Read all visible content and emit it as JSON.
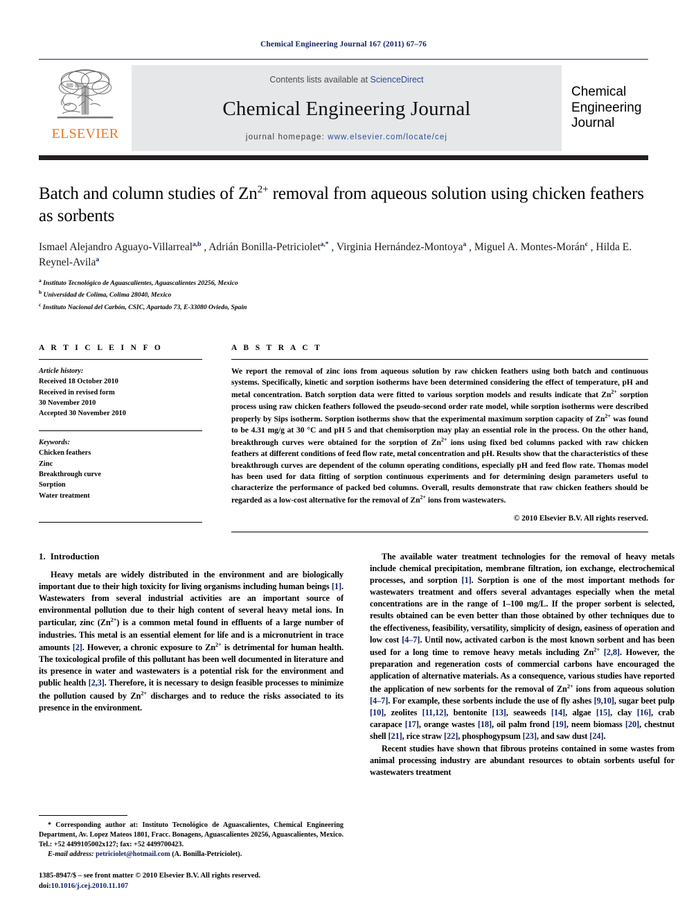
{
  "running_head": "Chemical Engineering Journal 167 (2011) 67–76",
  "banner": {
    "contents_prefix": "Contents lists available at ",
    "contents_link": "ScienceDirect",
    "journal_title": "Chemical Engineering Journal",
    "homepage_prefix": "journal homepage: ",
    "homepage_url": "www.elsevier.com/locate/cej",
    "publisher_wordmark": "ELSEVIER",
    "cover_title_line1": "Chemical",
    "cover_title_line2": "Engineering",
    "cover_title_line3": "Journal"
  },
  "article": {
    "title": "Batch and column studies of Zn2+ removal from aqueous solution using chicken feathers as sorbents",
    "title_part1": "Batch and column studies of Zn",
    "title_sup": "2+",
    "title_part2": " removal from aqueous solution using chicken feathers as sorbents",
    "authors": [
      {
        "name": "Ismael Alejandro Aguayo-Villarreal",
        "marks": "a,b"
      },
      {
        "name": "Adrián Bonilla-Petriciolet",
        "marks": "a,*"
      },
      {
        "name": "Virginia Hernández-Montoya",
        "marks": "a"
      },
      {
        "name": "Miguel A. Montes-Morán",
        "marks": "c"
      },
      {
        "name": "Hilda E. Reynel-Avila",
        "marks": "a"
      }
    ],
    "affiliations": [
      {
        "mark": "a",
        "text": "Instituto Tecnológico de Aguascalientes, Aguascalientes 20256, Mexico"
      },
      {
        "mark": "b",
        "text": "Universidad de Colima, Colima 28040, Mexico"
      },
      {
        "mark": "c",
        "text": "Instituto Nacional del Carbón, CSIC, Apartado 73, E-33080 Oviedo, Spain"
      }
    ]
  },
  "article_info": {
    "label": "A R T I C L E   I N F O",
    "history_label": "Article history:",
    "history": [
      "Received 18 October 2010",
      "Received in revised form",
      "30 November 2010",
      "Accepted 30 November 2010"
    ],
    "keywords_label": "Keywords:",
    "keywords": [
      "Chicken feathers",
      "Zinc",
      "Breakthrough curve",
      "Sorption",
      "Water treatment"
    ]
  },
  "abstract": {
    "label": "A B S T R A C T",
    "p1_a": "We report the removal of zinc ions from aqueous solution by raw chicken feathers using both batch and continuous systems. Specifically, kinetic and sorption isotherms have been determined considering the effect of temperature, pH and metal concentration. Batch sorption data were fitted to various sorption models and results indicate that Zn",
    "p1_b": " sorption process using raw chicken feathers followed the pseudo-second order rate model, while sorption isotherms were described properly by Sips isotherm. Sorption isotherms show that the experimental maximum sorption capacity of Zn",
    "p1_c": " was found to be 4.31 mg/g at 30 °C and pH 5 and that chemisorption may play an essential role in the process. On the other hand, breakthrough curves were obtained for the sorption of Zn",
    "p1_d": " ions using fixed bed columns packed with raw chicken feathers at different conditions of feed flow rate, metal concentration and pH. Results show that the characteristics of these breakthrough curves are dependent of the column operating conditions, especially pH and feed flow rate. Thomas model has been used for data fitting of sorption continuous experiments and for determining design parameters useful to characterize the performance of packed bed columns. Overall, results demonstrate that raw chicken feathers should be regarded as a low-cost alternative for the removal of Zn",
    "p1_e": " ions from wastewaters.",
    "sup": "2+",
    "copyright": "© 2010 Elsevier B.V. All rights reserved."
  },
  "body": {
    "section_number": "1.",
    "section_title": "Introduction",
    "left_p1_a": "Heavy metals are widely distributed in the environment and are biologically important due to their high toxicity for living organisms including human beings ",
    "left_p1_r1": "[1]",
    "left_p1_b": ". Wastewaters from several industrial activities are an important source of environmental pollution due to their high content of several heavy metal ions. In particular, zinc (Zn",
    "left_p1_sup1": "2+",
    "left_p1_c": ") is a common metal found in effluents of a large number of industries. This metal is an essential element for life and is a micronutrient in trace amounts ",
    "left_p1_r2": "[2]",
    "left_p1_d": ". However, a chronic exposure to Zn",
    "left_p1_sup2": "2+",
    "left_p1_e": " is detrimental for human health. The toxicological profile of this pollutant has been well documented in literature and its presence in water and wastewaters is a potential risk for the environment and public health ",
    "left_p1_r3": "[2,3]",
    "left_p1_f": ". Therefore, it is necessary to design feasible processes to minimize the pollution caused by Zn",
    "left_p1_sup3": "2+",
    "left_p1_g": " discharges and to reduce the risks associated to its presence in the environment.",
    "right_p1_a": "The available water treatment technologies for the removal of heavy metals include chemical precipitation, membrane filtration, ion exchange, electrochemical processes, and sorption ",
    "right_p1_r1": "[1]",
    "right_p1_b": ". Sorption is one of the most important methods for wastewaters treatment and offers several advantages especially when the metal concentrations are in the range of 1–100 mg/L. If the proper sorbent is selected, results obtained can be even better than those obtained by other techniques due to the effectiveness, feasibility, versatility, simplicity of design, easiness of operation and low cost ",
    "right_p1_r2": "[4–7]",
    "right_p1_c": ". Until now, activated carbon is the most known sorbent and has been used for a long time to remove heavy metals including Zn",
    "right_p1_sup1": "2+",
    "right_p1_r3": "[2,8]",
    "right_p1_d": ". However, the preparation and regeneration costs of commercial carbons have encouraged the application of alternative materials. As a consequence, various studies have reported the application of new sorbents for the removal of Zn",
    "right_p1_sup2": "2+",
    "right_p1_e": " ions from aqueous solution ",
    "right_p1_r4": "[4–7]",
    "right_p1_f": ". For example, these sorbents include the use of fly ashes ",
    "right_p1_r5": "[9,10]",
    "right_p1_g": ", sugar beet pulp ",
    "right_p1_r6": "[10]",
    "right_p1_h": ", zeolites ",
    "right_p1_r7": "[11,12]",
    "right_p1_i": ", bentonite ",
    "right_p1_r8": "[13]",
    "right_p1_j": ", seaweeds ",
    "right_p1_r9": "[14]",
    "right_p1_k": ", algae ",
    "right_p1_r10": "[15]",
    "right_p1_l": ", clay ",
    "right_p1_r11": "[16]",
    "right_p1_m": ", crab carapace ",
    "right_p1_r12": "[17]",
    "right_p1_n": ", orange wastes ",
    "right_p1_r13": "[18]",
    "right_p1_o": ", oil palm frond ",
    "right_p1_r14": "[19]",
    "right_p1_p": ", neem biomass ",
    "right_p1_r15": "[20]",
    "right_p1_q": ", chestnut shell ",
    "right_p1_r16": "[21]",
    "right_p1_r": ", rice straw ",
    "right_p1_r17": "[22]",
    "right_p1_s": ", phosphogypsum ",
    "right_p1_r18": "[23]",
    "right_p1_t": ", and saw dust ",
    "right_p1_r19": "[24]",
    "right_p1_u": ".",
    "right_p2": "Recent studies have shown that fibrous proteins contained in some wastes from animal processing industry are abundant resources to obtain sorbents useful for wastewaters treatment"
  },
  "footnotes": {
    "corresponding_star": "*",
    "corresponding_text": " Corresponding author at: Instituto Tecnológico de Aguascalientes, Chemical Engineering Department, Av. Lopez Mateos 1801, Fracc. Bonagens, Aguascalientes 20256, Aguascalientes, Mexico. Tel.: +52 4499105002x127; fax: +52 4499700423.",
    "email_label": "E-mail address:",
    "email": "petriciolet@hotmail.com",
    "email_owner": " (A. Bonilla-Petriciolet).",
    "issn_line": "1385-8947/$ – see front matter © 2010 Elsevier B.V. All rights reserved.",
    "doi_label": "doi:",
    "doi_value": "10.1016/j.cej.2010.11.107"
  },
  "colors": {
    "link_blue": "#11226b",
    "elsevier_orange": "#e87722",
    "banner_gray": "#e6e7e8",
    "rule_dark": "#231f20"
  }
}
